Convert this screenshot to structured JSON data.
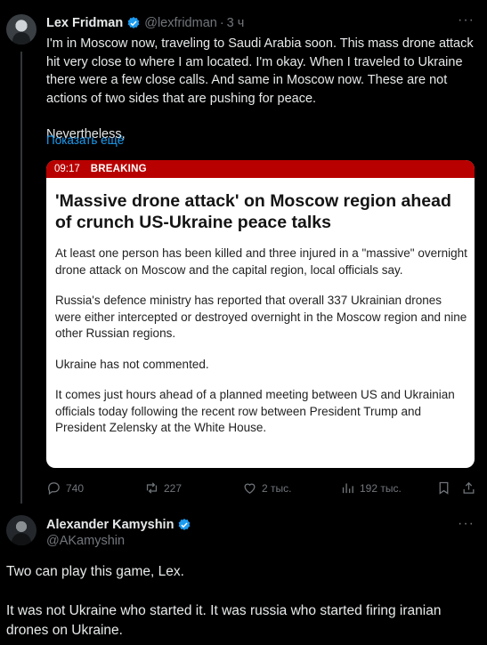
{
  "tweet1": {
    "author_name": "Lex Fridman",
    "handle": "@lexfridman",
    "time": "3 ч",
    "paragraphs": [
      "I'm in Moscow now, traveling to Saudi Arabia soon. This mass drone attack hit very close to where I am located. I'm okay. When I traveled to Ukraine there were a few close calls. And same in Moscow now. These are not actions of two sides that are pushing for peace.",
      "Nevertheless,"
    ],
    "show_more": "Показать ещё",
    "card": {
      "time": "09:17",
      "tag": "BREAKING",
      "title": "'Massive drone attack' on Moscow region ahead of crunch US-Ukraine peace talks",
      "paragraphs": [
        "At least one person has been killed and three injured in a \"massive\" overnight drone attack on Moscow and the capital region, local officials say.",
        "Russia's defence ministry has reported that overall 337 Ukrainian drones were either intercepted or destroyed overnight in the Moscow region and nine other Russian regions.",
        "Ukraine has not commented.",
        "It comes just hours ahead of a planned meeting between US and Ukrainian officials today following the recent row between President Trump and President Zelensky at the White House."
      ]
    },
    "stats": {
      "replies": "740",
      "reposts": "227",
      "likes": "2 тыс.",
      "views": "192 тыс."
    }
  },
  "tweet2": {
    "author_name": "Alexander Kamyshin",
    "handle": "@AKamyshin",
    "paragraphs": [
      "Two can play this game, Lex.",
      "It was not Ukraine who started it. It was russia who started firing iranian drones on Ukraine."
    ]
  },
  "colors": {
    "background": "#000000",
    "accent_link": "#1d9bf0",
    "breaking_red": "#b80000",
    "muted": "#71767b"
  }
}
